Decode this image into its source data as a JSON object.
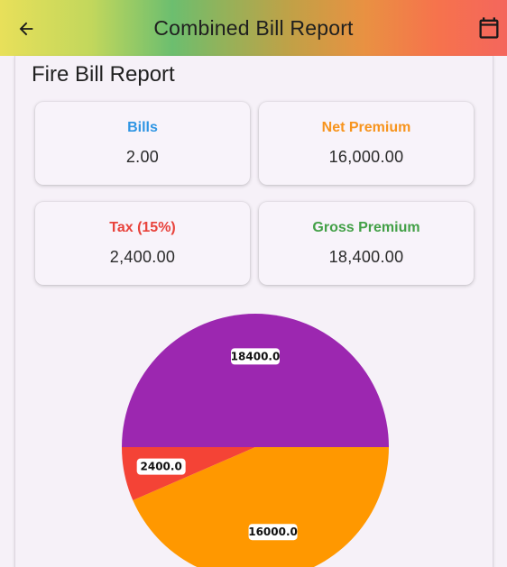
{
  "appbar": {
    "title": "Combined Bill Report",
    "back_icon": "arrow-left-icon",
    "calendar_icon": "calendar-icon"
  },
  "report": {
    "title": "Fire Bill Report",
    "stats": [
      {
        "label": "Bills",
        "value": "2.00",
        "color": "#2f95e3"
      },
      {
        "label": "Net Premium",
        "value": "16,000.00",
        "color": "#f7941d"
      },
      {
        "label": "Tax (15%)",
        "value": "2,400.00",
        "color": "#e8423b"
      },
      {
        "label": "Gross Premium",
        "value": "18,400.00",
        "color": "#43a047"
      }
    ]
  },
  "chart_data": {
    "type": "pie",
    "title": "",
    "slices": [
      {
        "label": "18400.0",
        "value": 18400.0,
        "color": "#9c27b0"
      },
      {
        "label": "16000.0",
        "value": 16000.0,
        "color": "#ff9800"
      },
      {
        "label": "2400.0",
        "value": 2400.0,
        "color": "#f44336"
      }
    ]
  }
}
